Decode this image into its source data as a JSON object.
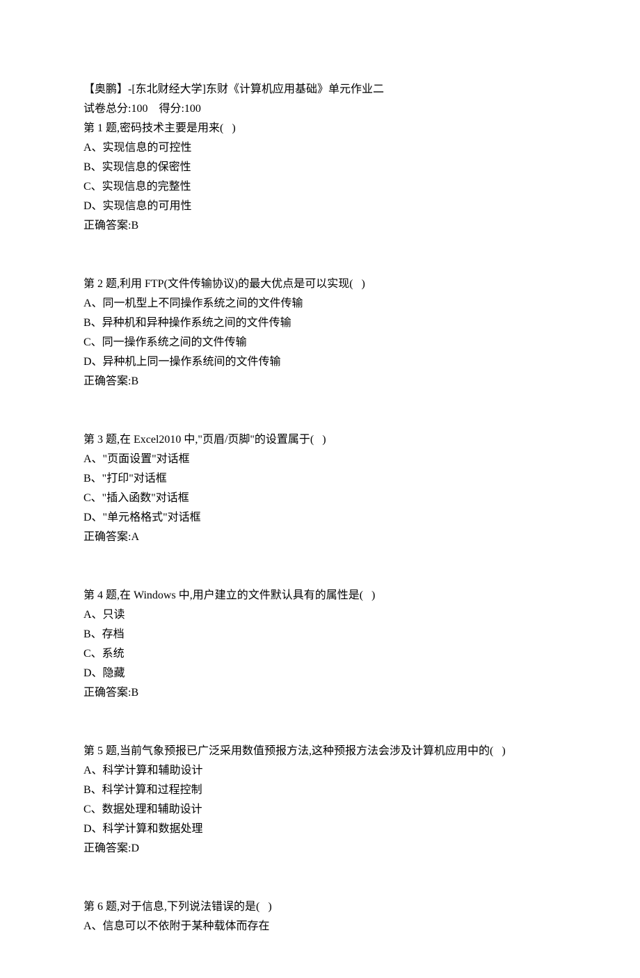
{
  "header": {
    "title": "【奥鹏】-[东北财经大学]东财《计算机应用基础》单元作业二",
    "score_line": "试卷总分:100    得分:100"
  },
  "questions": [
    {
      "stem": "第 1 题,密码技术主要是用来(   )",
      "options": [
        "A、实现信息的可控性",
        "B、实现信息的保密性",
        "C、实现信息的完整性",
        "D、实现信息的可用性"
      ],
      "answer": "正确答案:B"
    },
    {
      "stem": "第 2 题,利用 FTP(文件传输协议)的最大优点是可以实现(   )",
      "options": [
        "A、同一机型上不同操作系统之间的文件传输",
        "B、异种机和异种操作系统之间的文件传输",
        "C、同一操作系统之间的文件传输",
        "D、异种机上同一操作系统间的文件传输"
      ],
      "answer": "正确答案:B"
    },
    {
      "stem": "第 3 题,在 Excel2010 中,\"页眉/页脚\"的设置属于(   )",
      "options": [
        "A、\"页面设置\"对话框",
        "B、\"打印\"对话框",
        "C、\"插入函数\"对话框",
        "D、\"单元格格式\"对话框"
      ],
      "answer": "正确答案:A"
    },
    {
      "stem": "第 4 题,在 Windows 中,用户建立的文件默认具有的属性是(   )",
      "options": [
        "A、只读",
        "B、存档",
        "C、系统",
        "D、隐藏"
      ],
      "answer": "正确答案:B"
    },
    {
      "stem": "第 5 题,当前气象预报已广泛采用数值预报方法,这种预报方法会涉及计算机应用中的(   )",
      "options": [
        "A、科学计算和辅助设计",
        "B、科学计算和过程控制",
        "C、数据处理和辅助设计",
        "D、科学计算和数据处理"
      ],
      "answer": "正确答案:D"
    },
    {
      "stem": "第 6 题,对于信息,下列说法错误的是(   )",
      "options": [
        "A、信息可以不依附于某种载体而存在"
      ],
      "answer": ""
    }
  ]
}
